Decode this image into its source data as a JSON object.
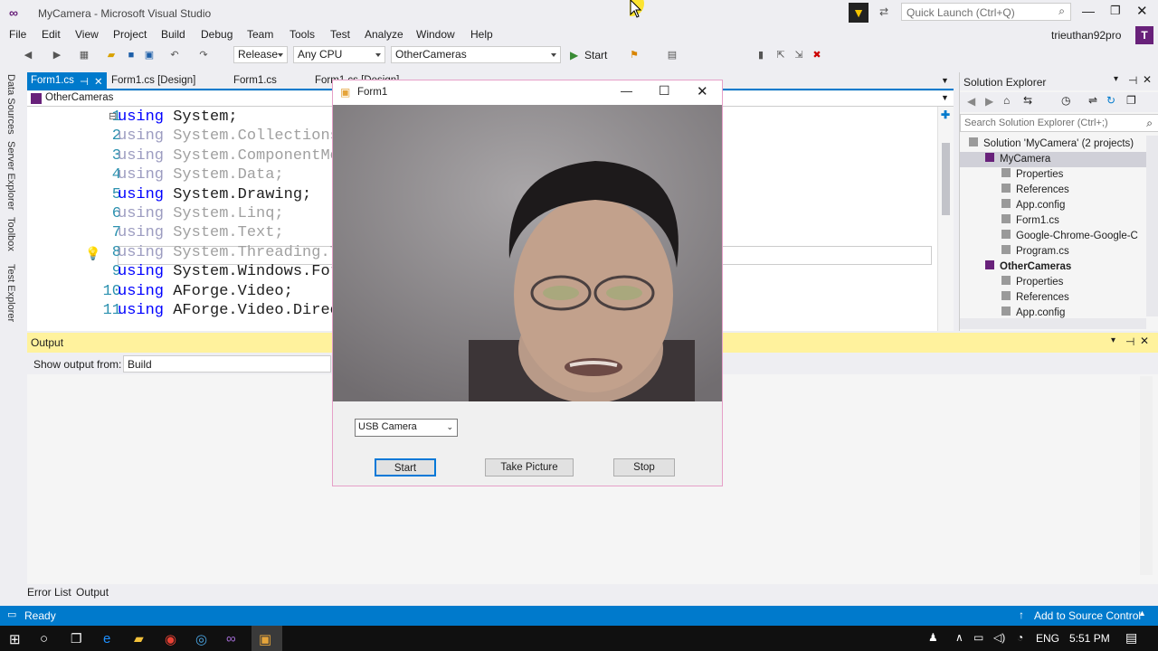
{
  "window": {
    "title": "MyCamera - Microsoft Visual Studio",
    "quick_launch_placeholder": "Quick Launch (Ctrl+Q)",
    "user": "trieuthan92pro",
    "avatar_letter": "T"
  },
  "menu": [
    "File",
    "Edit",
    "View",
    "Project",
    "Build",
    "Debug",
    "Team",
    "Tools",
    "Test",
    "Analyze",
    "Window",
    "Help"
  ],
  "toolbar": {
    "config": "Release",
    "platform": "Any CPU",
    "project": "OtherCameras",
    "start": "Start"
  },
  "side_tabs": [
    "Data Sources",
    "Server Explorer",
    "Toolbox",
    "Test Explorer"
  ],
  "editor_tabs": [
    "Form1.cs",
    "Form1.cs [Design]",
    "Form1.cs",
    "Form1.cs [Design]"
  ],
  "nav_project": "OtherCameras",
  "code": {
    "line_numbers": [
      "1",
      "2",
      "3",
      "4",
      "5",
      "6",
      "7",
      "8",
      "9",
      "10",
      "11"
    ],
    "lines": [
      {
        "kw": "using",
        "rest": " System;",
        "dim": false
      },
      {
        "kw": "using",
        "rest": " System.Collections.Generic;",
        "dim": true
      },
      {
        "kw": "using",
        "rest": " System.ComponentModel;",
        "dim": true
      },
      {
        "kw": "using",
        "rest": " System.Data;",
        "dim": true
      },
      {
        "kw": "using",
        "rest": " System.Drawing;",
        "dim": false
      },
      {
        "kw": "using",
        "rest": " System.Linq;",
        "dim": true
      },
      {
        "kw": "using",
        "rest": " System.Text;",
        "dim": true
      },
      {
        "kw": "using",
        "rest": " System.Threading.Tasks;",
        "dim": true
      },
      {
        "kw": "using",
        "rest": " System.Windows.Forms;",
        "dim": false
      },
      {
        "kw": "using",
        "rest": " AForge.Video;",
        "dim": false
      },
      {
        "kw": "using",
        "rest": " AForge.Video.DirectShow;",
        "dim": false
      }
    ]
  },
  "solution_explorer": {
    "title": "Solution Explorer",
    "search_placeholder": "Search Solution Explorer (Ctrl+;)",
    "items": [
      {
        "label": "Solution 'MyCamera' (2 projects)",
        "level": 0
      },
      {
        "label": "MyCamera",
        "level": 1
      },
      {
        "label": "Properties",
        "level": 2
      },
      {
        "label": "References",
        "level": 2
      },
      {
        "label": "App.config",
        "level": 2
      },
      {
        "label": "Form1.cs",
        "level": 2
      },
      {
        "label": "Google-Chrome-Google-C",
        "level": 2
      },
      {
        "label": "Program.cs",
        "level": 2
      },
      {
        "label": "OtherCameras",
        "level": 1
      },
      {
        "label": "Properties",
        "level": 2
      },
      {
        "label": "References",
        "level": 2
      },
      {
        "label": "App.config",
        "level": 2
      }
    ]
  },
  "output": {
    "title": "Output",
    "show_from_label": "Show output from:",
    "show_from_value": "Build"
  },
  "bottom_tabs": [
    "Error List",
    "Output"
  ],
  "status": {
    "text": "Ready",
    "source_control": "Add to Source Control"
  },
  "form1": {
    "title": "Form1",
    "camera_combo": "USB Camera",
    "start": "Start",
    "take_picture": "Take Picture",
    "stop": "Stop"
  },
  "taskbar": {
    "language": "ENG",
    "time": "5:51 PM"
  },
  "colors": {
    "accent": "#007acc",
    "vs_purple": "#68217a",
    "output_header": "#fff29d"
  }
}
